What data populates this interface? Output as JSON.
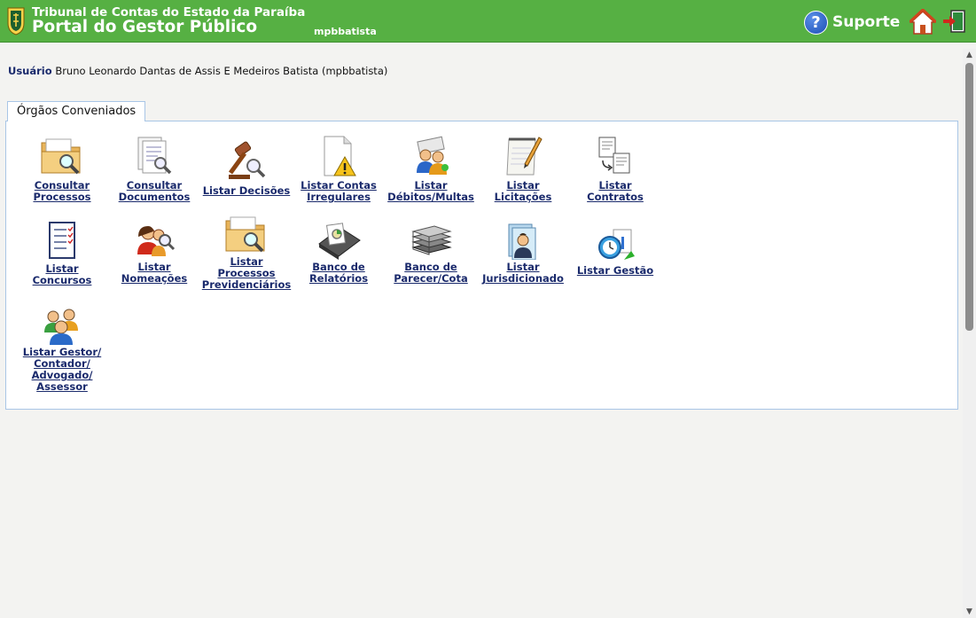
{
  "header": {
    "org_name": "Tribunal de Contas do Estado da Paraíba",
    "portal_name": "Portal do Gestor Público",
    "username": "mpbbatista",
    "support_label": "Suporte",
    "support_glyph": "?"
  },
  "user": {
    "label": "Usuário",
    "value": "Bruno Leonardo Dantas de Assis E Medeiros Batista (mpbbatista)"
  },
  "tab": {
    "label": "Órgãos Conveniados"
  },
  "items": [
    {
      "label": "Consultar Processos",
      "icon": "folder-search-icon"
    },
    {
      "label": "Consultar Documentos",
      "icon": "document-search-icon"
    },
    {
      "label": "Listar Decisões",
      "icon": "gavel-icon"
    },
    {
      "label": "Listar Contas Irregulares",
      "icon": "document-warning-icon"
    },
    {
      "label": "Listar Débitos/Multas",
      "icon": "users-money-icon"
    },
    {
      "label": "Listar Licitações",
      "icon": "notepad-pencil-icon"
    },
    {
      "label": "Listar Contratos",
      "icon": "documents-transfer-icon"
    },
    {
      "label": "Listar Concursos",
      "icon": "checklist-icon"
    },
    {
      "label": "Listar Nomeações",
      "icon": "users-search-icon"
    },
    {
      "label": "Listar Processos Previdenciários",
      "icon": "folder-search-icon"
    },
    {
      "label": "Banco de Relatórios",
      "icon": "report-tray-icon"
    },
    {
      "label": "Banco de Parecer/Cota",
      "icon": "books-stack-icon"
    },
    {
      "label": "Listar Jurisdicionado",
      "icon": "user-folder-icon"
    },
    {
      "label": "Listar Gestão",
      "icon": "chart-clock-icon"
    },
    {
      "label": "Listar Gestor/ Contador/ Advogado/ Assessor",
      "icon": "users-group-icon"
    }
  ],
  "colors": {
    "header_bg": "#56b043",
    "link": "#1a2a6c",
    "panel_border": "#a9c6e6"
  }
}
